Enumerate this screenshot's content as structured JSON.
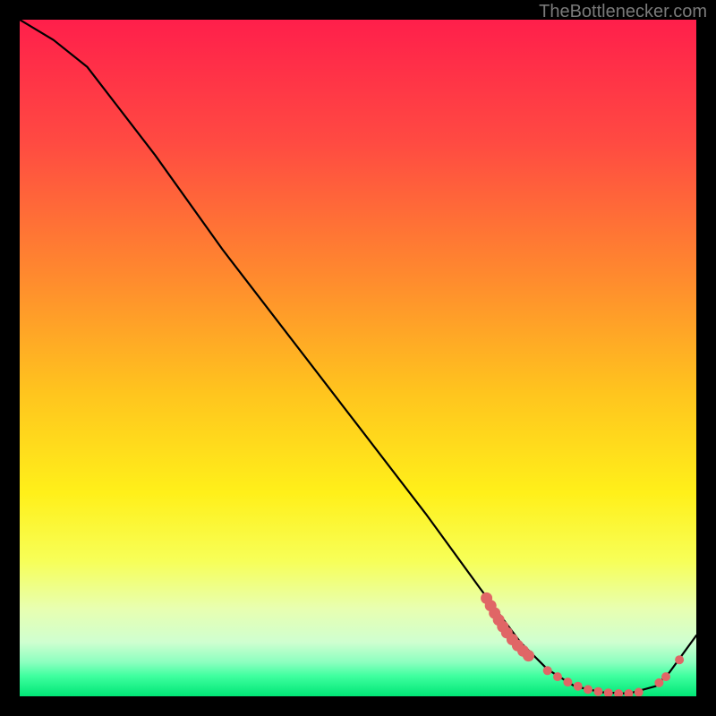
{
  "watermark": "TheBottlenecker.com",
  "chart_data": {
    "type": "line",
    "title": "",
    "xlabel": "",
    "ylabel": "",
    "xlim": [
      0,
      100
    ],
    "ylim": [
      0,
      100
    ],
    "gradient_stops": [
      {
        "offset": 0,
        "color": "#ff1f4b"
      },
      {
        "offset": 18,
        "color": "#ff4a42"
      },
      {
        "offset": 38,
        "color": "#ff8a2e"
      },
      {
        "offset": 55,
        "color": "#ffc41e"
      },
      {
        "offset": 70,
        "color": "#fff01a"
      },
      {
        "offset": 80,
        "color": "#f7ff58"
      },
      {
        "offset": 87,
        "color": "#e8ffb0"
      },
      {
        "offset": 92,
        "color": "#cfffd0"
      },
      {
        "offset": 95,
        "color": "#8bffbf"
      },
      {
        "offset": 97,
        "color": "#3fff9f"
      },
      {
        "offset": 100,
        "color": "#00e676"
      }
    ],
    "series": [
      {
        "name": "curve",
        "color": "#000000",
        "x": [
          0,
          5,
          10,
          20,
          30,
          40,
          50,
          60,
          68,
          74,
          78,
          82,
          86,
          90,
          94,
          96,
          100
        ],
        "y": [
          100,
          97,
          93,
          80,
          66,
          53,
          40,
          27,
          16,
          8,
          4,
          1.5,
          0.6,
          0.4,
          1.5,
          3.5,
          9
        ]
      }
    ],
    "markers": {
      "name": "highlight-dots",
      "color": "#e06666",
      "radius_large": 6.5,
      "radius_small": 5,
      "points": [
        {
          "x": 69.0,
          "y": 14.5,
          "r": "large"
        },
        {
          "x": 69.6,
          "y": 13.4,
          "r": "large"
        },
        {
          "x": 70.2,
          "y": 12.3,
          "r": "large"
        },
        {
          "x": 70.8,
          "y": 11.3,
          "r": "large"
        },
        {
          "x": 71.4,
          "y": 10.3,
          "r": "large"
        },
        {
          "x": 72.0,
          "y": 9.4,
          "r": "large"
        },
        {
          "x": 72.8,
          "y": 8.4,
          "r": "large"
        },
        {
          "x": 73.6,
          "y": 7.5,
          "r": "large"
        },
        {
          "x": 74.4,
          "y": 6.7,
          "r": "large"
        },
        {
          "x": 75.2,
          "y": 6.0,
          "r": "large"
        },
        {
          "x": 78.0,
          "y": 3.8,
          "r": "small"
        },
        {
          "x": 79.5,
          "y": 2.9,
          "r": "small"
        },
        {
          "x": 81.0,
          "y": 2.1,
          "r": "small"
        },
        {
          "x": 82.5,
          "y": 1.5,
          "r": "small"
        },
        {
          "x": 84.0,
          "y": 1.0,
          "r": "small"
        },
        {
          "x": 85.5,
          "y": 0.7,
          "r": "small"
        },
        {
          "x": 87.0,
          "y": 0.5,
          "r": "small"
        },
        {
          "x": 88.5,
          "y": 0.4,
          "r": "small"
        },
        {
          "x": 90.0,
          "y": 0.4,
          "r": "small"
        },
        {
          "x": 91.5,
          "y": 0.6,
          "r": "small"
        },
        {
          "x": 94.5,
          "y": 2.0,
          "r": "small"
        },
        {
          "x": 95.5,
          "y": 2.9,
          "r": "small"
        },
        {
          "x": 97.5,
          "y": 5.4,
          "r": "small"
        }
      ]
    }
  }
}
